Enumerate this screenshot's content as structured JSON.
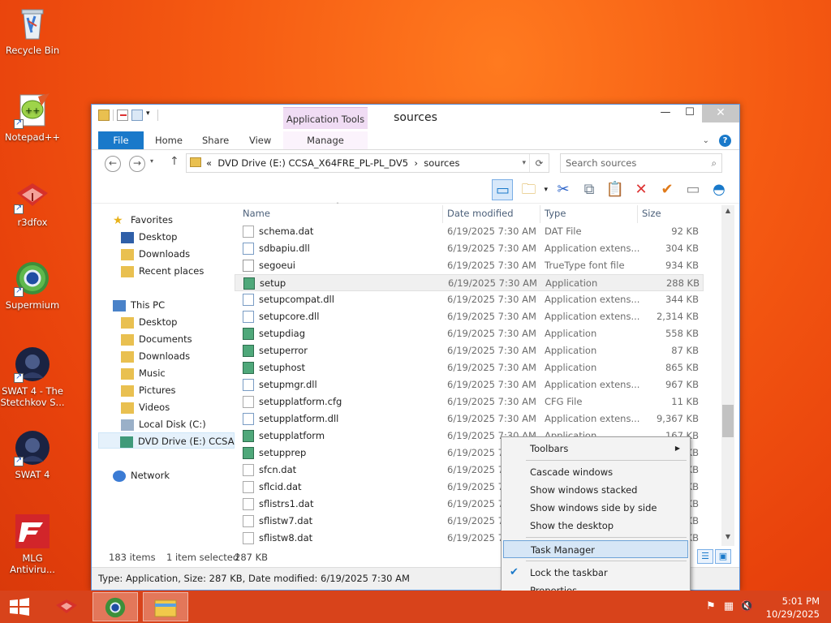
{
  "desktop": {
    "icons": [
      {
        "label": "Recycle Bin"
      },
      {
        "label": "Notepad++"
      },
      {
        "label": "r3dfox"
      },
      {
        "label": "Supermium"
      },
      {
        "label": "SWAT 4 - The Stetchkov S..."
      },
      {
        "label": "SWAT 4"
      },
      {
        "label": "MLG Antiviru..."
      }
    ]
  },
  "explorer": {
    "title": "sources",
    "app_tools_label": "Application Tools",
    "ribbon_tabs": {
      "file": "File",
      "home": "Home",
      "share": "Share",
      "view": "View",
      "manage": "Manage"
    },
    "address": {
      "prefix": "«",
      "path1": "DVD Drive (E:) CCSA_X64FRE_PL-PL_DV5",
      "sep": "›",
      "path2": "sources"
    },
    "search_placeholder": "Search sources",
    "nav": {
      "favorites": "Favorites",
      "desktop": "Desktop",
      "downloads": "Downloads",
      "recent": "Recent places",
      "thispc": "This PC",
      "pc_desktop": "Desktop",
      "documents": "Documents",
      "pc_downloads": "Downloads",
      "music": "Music",
      "pictures": "Pictures",
      "videos": "Videos",
      "localdisk": "Local Disk (C:)",
      "dvd": "DVD Drive (E:) CCSA",
      "network": "Network"
    },
    "columns": {
      "name": "Name",
      "date": "Date modified",
      "type": "Type",
      "size": "Size"
    },
    "files": [
      {
        "name": "schema.dat",
        "date": "6/19/2025 7:30 AM",
        "type": "DAT File",
        "size": "92 KB"
      },
      {
        "name": "sdbapiu.dll",
        "date": "6/19/2025 7:30 AM",
        "type": "Application extens...",
        "size": "304 KB"
      },
      {
        "name": "segoeui",
        "date": "6/19/2025 7:30 AM",
        "type": "TrueType font file",
        "size": "934 KB"
      },
      {
        "name": "setup",
        "date": "6/19/2025 7:30 AM",
        "type": "Application",
        "size": "288 KB"
      },
      {
        "name": "setupcompat.dll",
        "date": "6/19/2025 7:30 AM",
        "type": "Application extens...",
        "size": "344 KB"
      },
      {
        "name": "setupcore.dll",
        "date": "6/19/2025 7:30 AM",
        "type": "Application extens...",
        "size": "2,314 KB"
      },
      {
        "name": "setupdiag",
        "date": "6/19/2025 7:30 AM",
        "type": "Application",
        "size": "558 KB"
      },
      {
        "name": "setuperror",
        "date": "6/19/2025 7:30 AM",
        "type": "Application",
        "size": "87 KB"
      },
      {
        "name": "setuphost",
        "date": "6/19/2025 7:30 AM",
        "type": "Application",
        "size": "865 KB"
      },
      {
        "name": "setupmgr.dll",
        "date": "6/19/2025 7:30 AM",
        "type": "Application extens...",
        "size": "967 KB"
      },
      {
        "name": "setupplatform.cfg",
        "date": "6/19/2025 7:30 AM",
        "type": "CFG File",
        "size": "11 KB"
      },
      {
        "name": "setupplatform.dll",
        "date": "6/19/2025 7:30 AM",
        "type": "Application extens...",
        "size": "9,367 KB"
      },
      {
        "name": "setupplatform",
        "date": "6/19/2025 7:30 AM",
        "type": "Application",
        "size": "167 KB"
      },
      {
        "name": "setupprep",
        "date": "6/19/2025 7:30 AM",
        "type": "",
        "size": "KB"
      },
      {
        "name": "sfcn.dat",
        "date": "6/19/2025 7:30 AM",
        "type": "",
        "size": "KB"
      },
      {
        "name": "sflcid.dat",
        "date": "6/19/2025 7:30 AM",
        "type": "",
        "size": "KB"
      },
      {
        "name": "sflistrs1.dat",
        "date": "6/19/2025 7:30 AM",
        "type": "",
        "size": "KB"
      },
      {
        "name": "sflistw7.dat",
        "date": "6/19/2025 7:30 AM",
        "type": "",
        "size": "KB"
      },
      {
        "name": "sflistw8.dat",
        "date": "6/19/2025 7:30 AM",
        "type": "",
        "size": "KB"
      }
    ],
    "status": {
      "count": "183 items",
      "selected": "1 item selected",
      "selsize": "287 KB"
    },
    "infobar": "Type: Application, Size: 287 KB, Date modified: 6/19/2025 7:30 AM"
  },
  "context_menu": {
    "toolbars": "Toolbars",
    "cascade": "Cascade windows",
    "stacked": "Show windows stacked",
    "sidebyside": "Show windows side by side",
    "showdesktop": "Show the desktop",
    "taskmanager": "Task Manager",
    "lock": "Lock the taskbar",
    "properties": "Properties"
  },
  "taskbar": {
    "time": "5:01 PM",
    "date": "10/29/2025"
  },
  "colors": {
    "accent": "#1979ca",
    "desktop": "#f05a14",
    "taskbar": "#d8431b"
  }
}
